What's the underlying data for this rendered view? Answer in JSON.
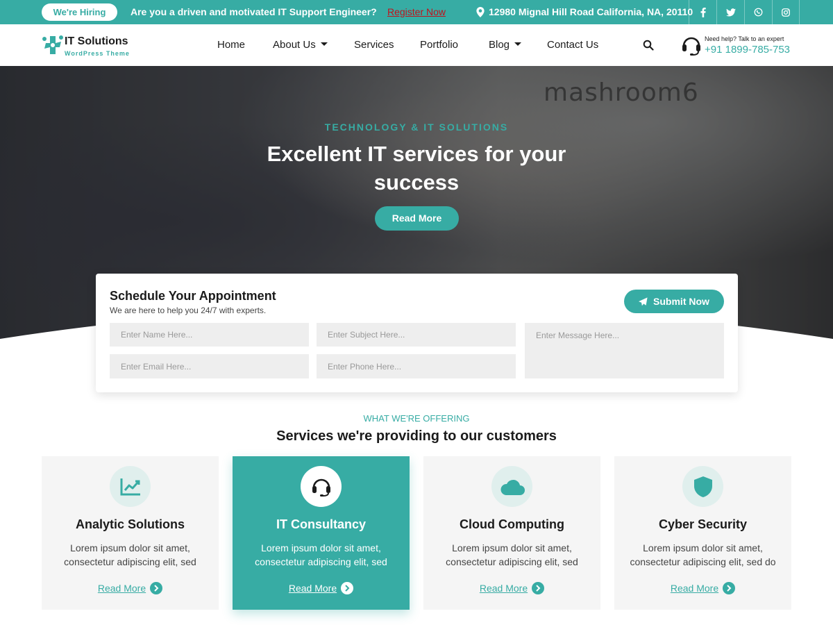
{
  "topbar": {
    "hiring_badge": "We're Hiring",
    "message": "Are you a driven and motivated IT Support Engineer?",
    "register_link": "Register Now",
    "address": "12980 Mignal Hill Road California, NA, 20110",
    "socials": [
      "facebook-icon",
      "twitter-icon",
      "whatsapp-icon",
      "instagram-icon"
    ]
  },
  "header": {
    "brand": "IT Solutions",
    "brand_sub": "WordPress Theme",
    "nav": [
      "Home",
      "About Us",
      "Services",
      "Portfolio",
      "Blog",
      "Contact Us"
    ],
    "help_text": "Need help? Talk to an expert",
    "phone": "+91 1899-785-753"
  },
  "hero": {
    "board_text": "mashroom6",
    "kicker": "TECHNOLOGY & IT SOLUTIONS",
    "title": "Excellent IT services for your success",
    "button": "Read More"
  },
  "appointment": {
    "title": "Schedule Your Appointment",
    "subtitle": "We are here to help you 24/7 with experts.",
    "submit": "Submit Now",
    "fields": {
      "name": "Enter Name Here...",
      "subject": "Enter Subject Here...",
      "message": "Enter Message Here...",
      "email": "Enter Email Here...",
      "phone": "Enter Phone Here..."
    }
  },
  "services": {
    "kicker": "WHAT WE'RE OFFERING",
    "title": "Services we're providing to our customers",
    "cards": [
      {
        "title": "Analytic Solutions",
        "desc": "Lorem ipsum dolor sit amet, consectetur adipiscing elit, sed",
        "link": "Read More",
        "icon": "chart-icon"
      },
      {
        "title": "IT Consultancy",
        "desc": "Lorem ipsum dolor sit amet, consectetur adipiscing elit, sed",
        "link": "Read More",
        "icon": "headset-icon"
      },
      {
        "title": "Cloud Computing",
        "desc": "Lorem ipsum dolor sit amet, consectetur adipiscing elit, sed",
        "link": "Read More",
        "icon": "cloud-icon"
      },
      {
        "title": "Cyber Security",
        "desc": "Lorem ipsum dolor sit amet, consectetur adipiscing elit, sed do",
        "link": "Read More",
        "icon": "shield-icon"
      }
    ]
  },
  "colors": {
    "accent": "#37aca4",
    "link_red": "#c0121c"
  }
}
